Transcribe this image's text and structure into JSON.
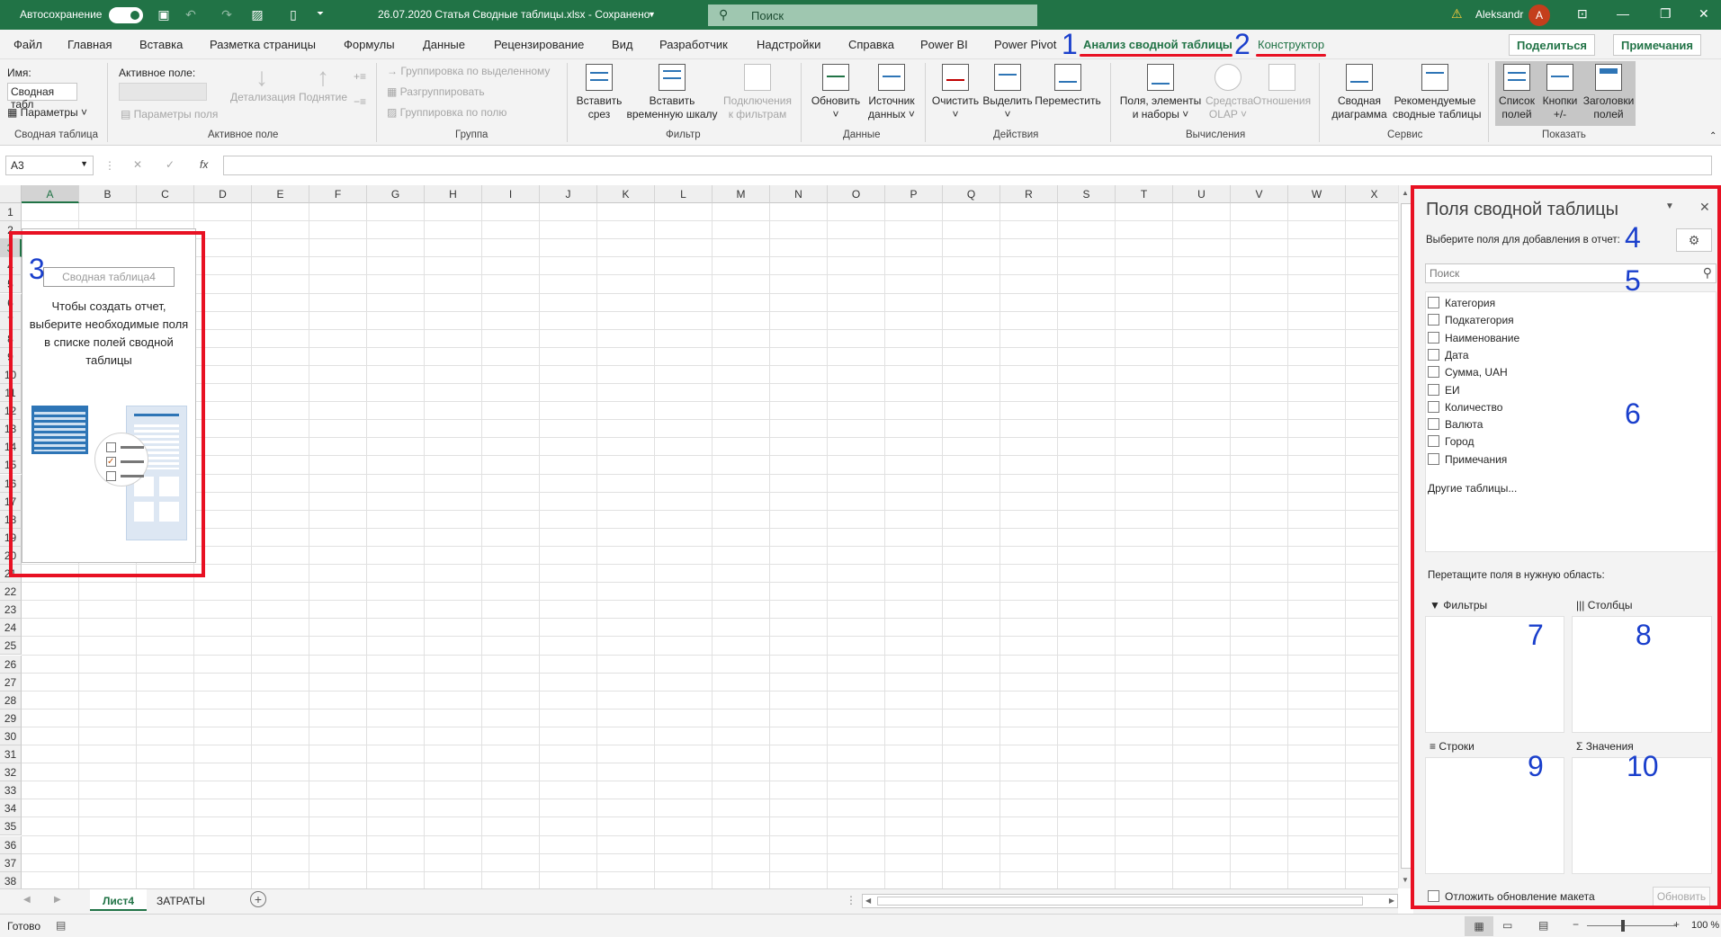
{
  "titlebar": {
    "autosave_label": "Автосохранение",
    "file_title": "26.07.2020 Статья Сводные таблицы.xlsx  -  Сохранено",
    "search_placeholder": "Поиск",
    "user_name": "Aleksandr",
    "avatar_letter": "A",
    "warning_glyph": "⚠"
  },
  "tabs": [
    {
      "label": "Файл"
    },
    {
      "label": "Главная"
    },
    {
      "label": "Вставка"
    },
    {
      "label": "Разметка страницы"
    },
    {
      "label": "Формулы"
    },
    {
      "label": "Данные"
    },
    {
      "label": "Рецензирование"
    },
    {
      "label": "Вид"
    },
    {
      "label": "Разработчик"
    },
    {
      "label": "Надстройки"
    },
    {
      "label": "Справка"
    },
    {
      "label": "Power BI"
    },
    {
      "label": "Power Pivot"
    },
    {
      "label": "Анализ сводной таблицы"
    },
    {
      "label": "Конструктор"
    }
  ],
  "share_label": "Поделиться",
  "comments_label": "Примечания",
  "annotations": [
    "1",
    "2",
    "3",
    "4",
    "5",
    "6",
    "7",
    "8",
    "9",
    "10"
  ],
  "ribbon": {
    "pivot": {
      "name_label": "Имя:",
      "name_value": "Сводная табл",
      "params_label": "Параметры",
      "group": "Сводная таблица"
    },
    "active_field": {
      "label": "Активное поле:",
      "field_params": "Параметры поля",
      "drill_down": "Детализация",
      "drill_up": "Поднятие",
      "group": "Активное поле"
    },
    "group_grp": {
      "by_selection": "Группировка по выделенному",
      "ungroup": "Разгруппировать",
      "by_field": "Группировка по полю",
      "group": "Группа"
    },
    "filter": {
      "insert_slicer": [
        "Вставить",
        "срез"
      ],
      "insert_timeline": [
        "Вставить",
        "временную шкалу"
      ],
      "filter_conn": [
        "Подключения",
        "к фильтрам"
      ],
      "group": "Фильтр"
    },
    "data": {
      "refresh": [
        "Обновить",
        "˅"
      ],
      "source": [
        "Источник",
        "данных ˅"
      ],
      "group": "Данные"
    },
    "actions": {
      "clear": [
        "Очистить",
        "˅"
      ],
      "select": [
        "Выделить",
        "˅"
      ],
      "move": "Переместить",
      "group": "Действия"
    },
    "calc": {
      "fields": [
        "Поля, элементы",
        "и наборы ˅"
      ],
      "olap": [
        "Средства",
        "OLAP ˅"
      ],
      "relations": "Отношения",
      "group": "Вычисления"
    },
    "tools": {
      "chart": [
        "Сводная",
        "диаграмма"
      ],
      "recommended": [
        "Рекомендуемые",
        "сводные таблицы"
      ],
      "group": "Сервис"
    },
    "show": {
      "field_list": [
        "Список",
        "полей"
      ],
      "buttons": [
        "Кнопки",
        "+/-"
      ],
      "headers": [
        "Заголовки",
        "полей"
      ],
      "group": "Показать"
    }
  },
  "formula_bar": {
    "name_box": "A3",
    "fx": "fx"
  },
  "grid": {
    "columns": [
      "A",
      "B",
      "C",
      "D",
      "E",
      "F",
      "G",
      "H",
      "I",
      "J",
      "K",
      "L",
      "M",
      "N",
      "O",
      "P",
      "Q",
      "R",
      "S",
      "T",
      "U",
      "V",
      "W",
      "X"
    ],
    "rows": [
      "1",
      "2",
      "3",
      "4",
      "5",
      "6",
      "7",
      "8",
      "9",
      "10",
      "11",
      "12",
      "13",
      "14",
      "15",
      "16",
      "17",
      "18",
      "19",
      "20",
      "21",
      "22",
      "23",
      "24",
      "25",
      "26",
      "27",
      "28",
      "29",
      "30",
      "31",
      "32",
      "33",
      "34",
      "35",
      "36",
      "37",
      "38"
    ]
  },
  "pivot_placeholder": {
    "name": "Сводная таблица4",
    "message": "Чтобы создать отчет, выберите необходимые поля в списке полей сводной таблицы"
  },
  "sheets": {
    "tabs": [
      "Лист4",
      "ЗАТРАТЫ"
    ],
    "add": "+"
  },
  "status": {
    "ready": "Готово",
    "zoom": "100 %"
  },
  "pane": {
    "title": "Поля сводной таблицы",
    "choose_label": "Выберите поля для добавления в отчет:",
    "search_placeholder": "Поиск",
    "fields": [
      "Категория",
      "Подкатегория",
      "Наименование",
      "Дата",
      "Сумма, UAH",
      "ЕИ",
      "Количество",
      "Валюта",
      "Город",
      "Примечания"
    ],
    "other_tables": "Другие таблицы...",
    "drag_label": "Перетащите поля в нужную область:",
    "areas": {
      "filters": "Фильтры",
      "columns": "Столбцы",
      "rows": "Строки",
      "values": "Значения"
    },
    "defer_label": "Отложить обновление макета",
    "update_label": "Обновить"
  }
}
